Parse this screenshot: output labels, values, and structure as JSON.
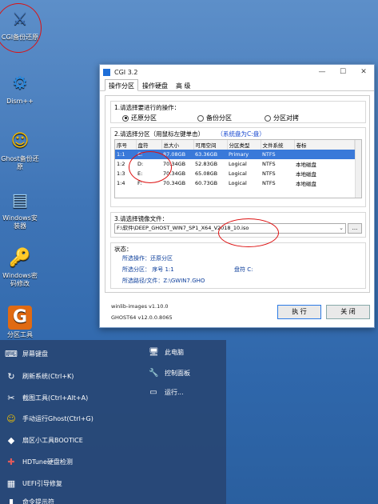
{
  "desktop": {
    "icons": [
      {
        "label": "CGI备份还原",
        "glyph": "⚔"
      },
      {
        "label": "Dism++",
        "glyph": "⚙"
      },
      {
        "label": "Ghost备份还原",
        "glyph": "☺"
      },
      {
        "label": "Windows安装器",
        "glyph": "▤"
      },
      {
        "label": "Windows密码修改",
        "glyph": "🔑"
      },
      {
        "label": "分区工具",
        "glyph": "G"
      }
    ]
  },
  "window": {
    "title": "CGI 3.2",
    "tabs": [
      "操作分区",
      "操作硬盘",
      "高 级"
    ],
    "step1": {
      "title": "1.请选择要进行的操作：",
      "options": [
        "还原分区",
        "备份分区",
        "分区对拷"
      ],
      "selected": 0
    },
    "step2": {
      "title": "2.请选择分区（用鼠标左键单击）",
      "hint": "（系统盘为C:盘）",
      "columns": [
        "序号",
        "盘符",
        "总大小",
        "可用空间",
        "分区类型",
        "文件系统",
        "卷标"
      ],
      "rows": [
        [
          "1:1",
          "C:",
          "87.08GB",
          "63.36GB",
          "Primary",
          "NTFS",
          ""
        ],
        [
          "1:2",
          "D:",
          "70.34GB",
          "52.83GB",
          "Logical",
          "NTFS",
          "本地磁盘"
        ],
        [
          "1:3",
          "E:",
          "70.34GB",
          "65.08GB",
          "Logical",
          "NTFS",
          "本地磁盘"
        ],
        [
          "1:4",
          "F:",
          "70.34GB",
          "60.73GB",
          "Logical",
          "NTFS",
          "本地磁盘"
        ]
      ]
    },
    "step3": {
      "title": "3.请选择镜像文件：",
      "path": "F:\\软件\\DEEP_GHOST_WIN7_SP1_X64_V2018_10.iso",
      "browse": "..."
    },
    "status": {
      "title": "状态：",
      "line1": "所选操作：还原分区",
      "line2_a": "所选分区：  序号 1:1",
      "line2_b": "盘符 C:",
      "line3": "所选路径/文件：Z:\\GWIN7.GHO"
    },
    "versions": [
      "winlib-images v1.10.0",
      "GHOST64 v12.0.0.8065"
    ],
    "buttons": {
      "execute": "执 行",
      "close": "关 闭"
    }
  },
  "start_menu": {
    "left_items": [
      {
        "label": "屏幕键盘",
        "glyph": "⌨"
      },
      {
        "label": "刷新系统(Ctrl+K)",
        "glyph": "↻"
      },
      {
        "label": "截图工具(Ctrl+Alt+A)",
        "glyph": "✂"
      },
      {
        "label": "手动运行Ghost(Ctrl+G)",
        "glyph": "☺"
      },
      {
        "label": "扇区小工具BOOTICE",
        "glyph": "◆"
      },
      {
        "label": "HDTune硬盘检测",
        "glyph": "✚"
      },
      {
        "label": "UEFI引导修复",
        "glyph": "▦"
      },
      {
        "label": "命令提示符",
        "glyph": "▮"
      }
    ],
    "right_items": [
      {
        "label": "此电脑",
        "glyph": "🖥"
      },
      {
        "label": "控制面板",
        "glyph": "🔧"
      },
      {
        "label": "运行...",
        "glyph": "▭"
      }
    ]
  },
  "colors": {
    "selection": "#3a79d9",
    "status_text": "#0a3c9a",
    "annotation": "#dd1111"
  }
}
